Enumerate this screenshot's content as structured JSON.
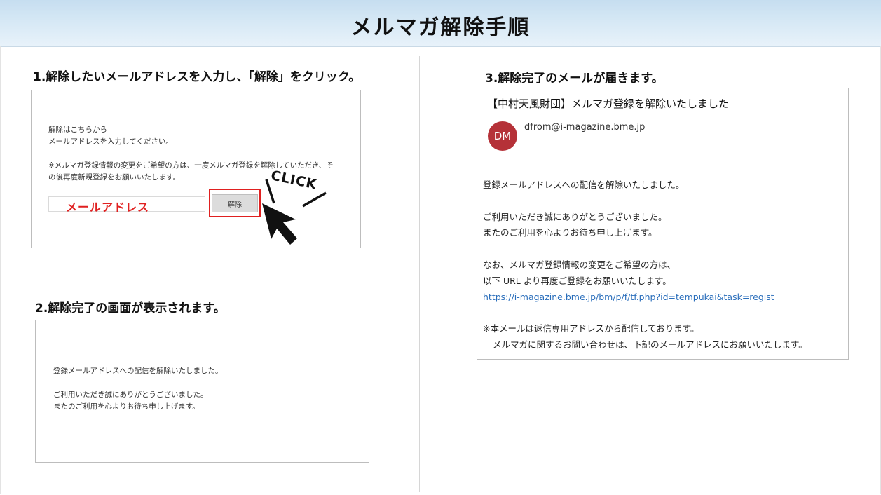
{
  "header": {
    "title": "メルマガ解除手順"
  },
  "step1": {
    "heading": "1.解除したいメールアドレスを入力し、「解除」をクリック。",
    "intro": [
      "解除はこちらから",
      "メールアドレスを入力してください。"
    ],
    "note": [
      "※メルマガ登録情報の変更をご希望の方は、一度メルマガ登録を解除していただき、そ",
      "の後再度新規登録をお願いいたします。"
    ],
    "email_placeholder": "メールアドレス",
    "cancel_label": "解除",
    "click_label": "CLICK"
  },
  "step2": {
    "heading": "2.解除完了の画面が表示されます。",
    "lines": [
      "登録メールアドレスへの配信を解除いたしました。",
      "ご利用いただき誠にありがとうございました。",
      "またのご利用を心よりお待ち申し上げます。"
    ]
  },
  "step3": {
    "heading": "3.解除完了のメールが届きます。",
    "subject": "【中村天風財団】メルマガ登録を解除いたしました",
    "avatar_initials": "DM",
    "from": "dfrom@i-magazine.bme.jp",
    "body": {
      "line1": "登録メールアドレスへの配信を解除いたしました。",
      "line2": "ご利用いただき誠にありがとうございました。",
      "line3": "またのご利用を心よりお待ち申し上げます。",
      "line4": "なお、メルマガ登録情報の変更をご希望の方は、",
      "line5": "以下 URL より再度ご登録をお願いいたします。",
      "link": "https://i-magazine.bme.jp/bm/p/f/tf.php?id=tempukai&task=regist",
      "line6": "※本メールは返信専用アドレスから配信しております。",
      "line7": "メルマガに関するお問い合わせは、下記のメールアドレスにお願いいたします。"
    }
  },
  "colors": {
    "accent_red": "#e02020",
    "avatar": "#b53138",
    "link": "#2a6ebb",
    "header_bg": "#d2e5f3"
  }
}
